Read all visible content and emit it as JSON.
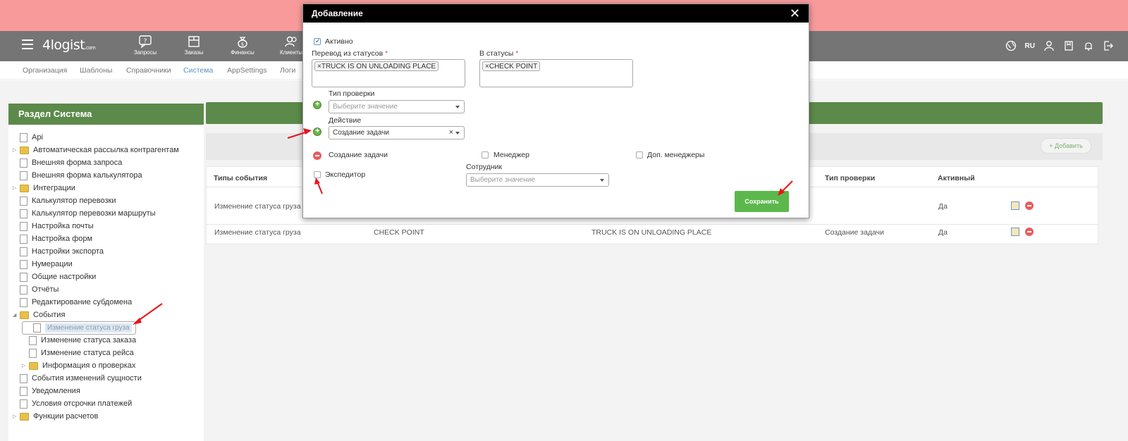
{
  "header": {
    "logo": "4logist",
    "logo_suffix": ".com",
    "nav": [
      {
        "label": "Запросы",
        "icon": "question-icon"
      },
      {
        "label": "Заказы",
        "icon": "box-icon"
      },
      {
        "label": "Финансы",
        "icon": "money-bag-icon"
      },
      {
        "label": "Клиенты",
        "icon": "users-icon"
      }
    ],
    "language": "RU"
  },
  "subnav": [
    "Организация",
    "Шаблоны",
    "Справочники",
    "Система",
    "AppSettings",
    "Логи"
  ],
  "sidebar": {
    "title": "Раздел Система",
    "items": [
      {
        "label": "Api",
        "type": "doc",
        "level": 0
      },
      {
        "label": "Автоматическая рассылка контрагентам",
        "type": "folder",
        "level": 0,
        "collapsed": true
      },
      {
        "label": "Внешняя форма запроса",
        "type": "doc",
        "level": 0
      },
      {
        "label": "Внешняя форма калькулятора",
        "type": "doc",
        "level": 0
      },
      {
        "label": "Интеграции",
        "type": "folder",
        "level": 0,
        "collapsed": true
      },
      {
        "label": "Калькулятор перевозки",
        "type": "doc",
        "level": 0
      },
      {
        "label": "Калькулятор перевозки маршруты",
        "type": "doc",
        "level": 0
      },
      {
        "label": "Настройка почты",
        "type": "doc",
        "level": 0
      },
      {
        "label": "Настройка форм",
        "type": "doc",
        "level": 0
      },
      {
        "label": "Настройки экспорта",
        "type": "doc",
        "level": 0
      },
      {
        "label": "Нумерации",
        "type": "doc",
        "level": 0
      },
      {
        "label": "Общие настройки",
        "type": "doc",
        "level": 0
      },
      {
        "label": "Отчёты",
        "type": "doc",
        "level": 0
      },
      {
        "label": "Редактирование субдомена",
        "type": "doc",
        "level": 0
      },
      {
        "label": "События",
        "type": "folder",
        "level": 0,
        "expanded": true
      },
      {
        "label": "Изменение статуса груза",
        "type": "doc",
        "level": 1,
        "selected": true
      },
      {
        "label": "Изменение статуса заказа",
        "type": "doc",
        "level": 1
      },
      {
        "label": "Изменение статуса рейса",
        "type": "doc",
        "level": 1
      },
      {
        "label": "Информация о проверках",
        "type": "folder",
        "level": 1,
        "collapsed": true
      },
      {
        "label": "События изменений сущности",
        "type": "doc",
        "level": 0
      },
      {
        "label": "Уведомления",
        "type": "doc",
        "level": 0
      },
      {
        "label": "Условия отсрочки платежей",
        "type": "doc",
        "level": 0
      },
      {
        "label": "Функции расчетов",
        "type": "folder",
        "level": 0,
        "collapsed": true
      }
    ]
  },
  "main": {
    "add_label": "Добавить",
    "columns": [
      "Типы события",
      "Тип проверки",
      "Активный"
    ],
    "rows": [
      {
        "event": "Изменение статуса груза",
        "to": "",
        "from": "",
        "check": "",
        "active": "Да"
      },
      {
        "event": "Изменение статуса груза",
        "to": "CHECK POINT",
        "from": "TRUCK IS ON UNLOADING PLACE",
        "check": "Создание задачи",
        "active": "Да"
      }
    ]
  },
  "modal": {
    "title": "Добавление",
    "active_label": "Активно",
    "from_label": "Перевод из статусов",
    "from_tag": "TRUCK IS ON UNLOADING PLACE",
    "to_label": "В статусы",
    "to_tag": "CHECK POINT",
    "check_type_label": "Тип проверки",
    "check_type_placeholder": "Выберите значение",
    "action_label": "Действие",
    "action_value": "Создание задачи",
    "action_row_label": "Создание задачи",
    "manager_label": "Менеджер",
    "extra_managers_label": "Доп. менеджеры",
    "forwarder_label": "Экспедитор",
    "employee_label": "Сотрудник",
    "employee_placeholder": "Выберите значение",
    "save_label": "Сохранить",
    "tag_remove": "×",
    "clear": "×"
  },
  "colors": {
    "green_header": "#5c8a4a",
    "pink_bar": "#f99a9a",
    "nav_bg": "#757575",
    "save_green": "#5cb84c",
    "annotation_arrow": "#e8141b"
  }
}
